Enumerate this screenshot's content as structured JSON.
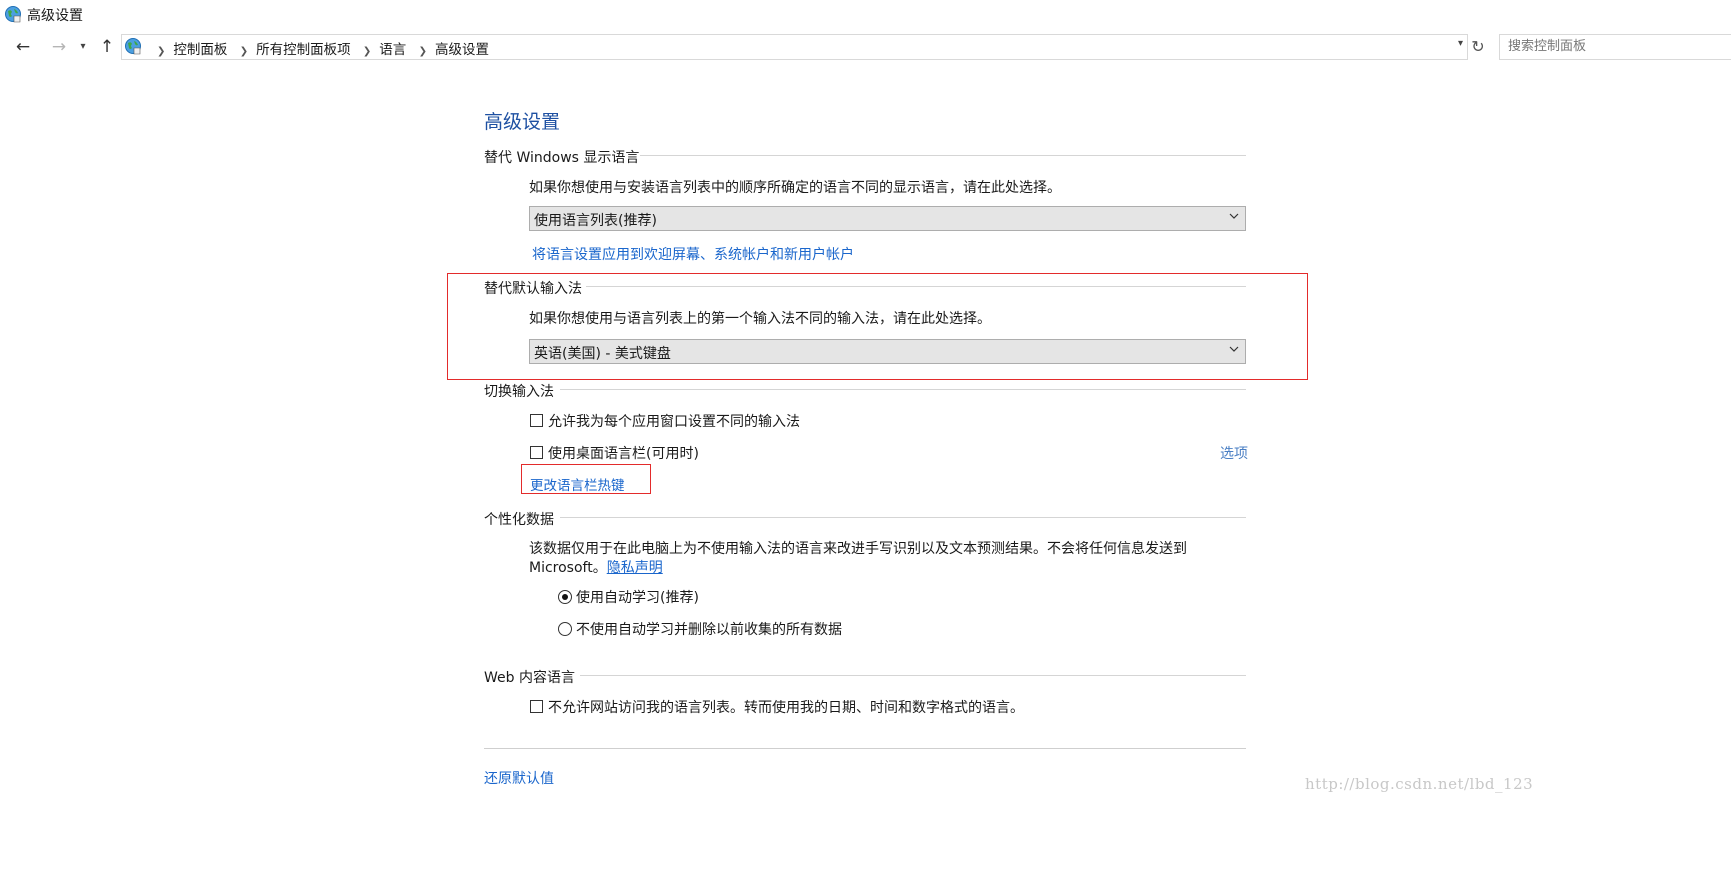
{
  "window": {
    "title": "高级设置",
    "icon": "globe-control-panel-icon"
  },
  "nav": {
    "back_icon": "arrow-left-icon",
    "forward_icon": "arrow-right-icon",
    "recent_icon": "chevron-down-icon",
    "up_icon": "arrow-up-icon",
    "breadcrumbs": [
      "控制面板",
      "所有控制面板项",
      "语言",
      "高级设置"
    ],
    "refresh_icon": "refresh-icon",
    "search_placeholder": "搜索控制面板"
  },
  "page": {
    "title": "高级设置",
    "display_language": {
      "heading": "替代 Windows 显示语言",
      "description": "如果你想使用与安装语言列表中的顺序所确定的语言不同的显示语言，请在此处选择。",
      "selected": "使用语言列表(推荐)",
      "apply_link": "将语言设置应用到欢迎屏幕、系统帐户和新用户帐户"
    },
    "default_input": {
      "heading": "替代默认输入法",
      "description": "如果你想使用与语言列表上的第一个输入法不同的输入法，请在此处选择。",
      "selected": "英语(美国) - 美式键盘"
    },
    "switch_input": {
      "heading": "切换输入法",
      "per_app_checkbox": {
        "label": "允许我为每个应用窗口设置不同的输入法",
        "checked": false
      },
      "language_bar_checkbox": {
        "label": "使用桌面语言栏(可用时)",
        "checked": false
      },
      "options_link": "选项",
      "hotkeys_link": "更改语言栏热键"
    },
    "personalization": {
      "heading": "个性化数据",
      "description_line1": "该数据仅用于在此电脑上为不使用输入法的语言来改进手写识别以及文本预测结果。不会将任何信息发送到",
      "description_line2": "Microsoft。",
      "privacy_link": "隐私声明",
      "radio_auto": {
        "label": "使用自动学习(推荐)",
        "selected": true
      },
      "radio_no_auto": {
        "label": "不使用自动学习并删除以前收集的所有数据",
        "selected": false
      }
    },
    "web_language": {
      "heading": "Web 内容语言",
      "checkbox": {
        "label": "不允许网站访问我的语言列表。转而使用我的日期、时间和数字格式的语言。",
        "checked": false
      }
    },
    "restore_defaults_link": "还原默认值"
  },
  "watermark": "http://blog.csdn.net/lbd_123",
  "colors": {
    "accent": "#1e50a2",
    "link": "#1a66cc",
    "highlight_box": "#e32b2b"
  }
}
